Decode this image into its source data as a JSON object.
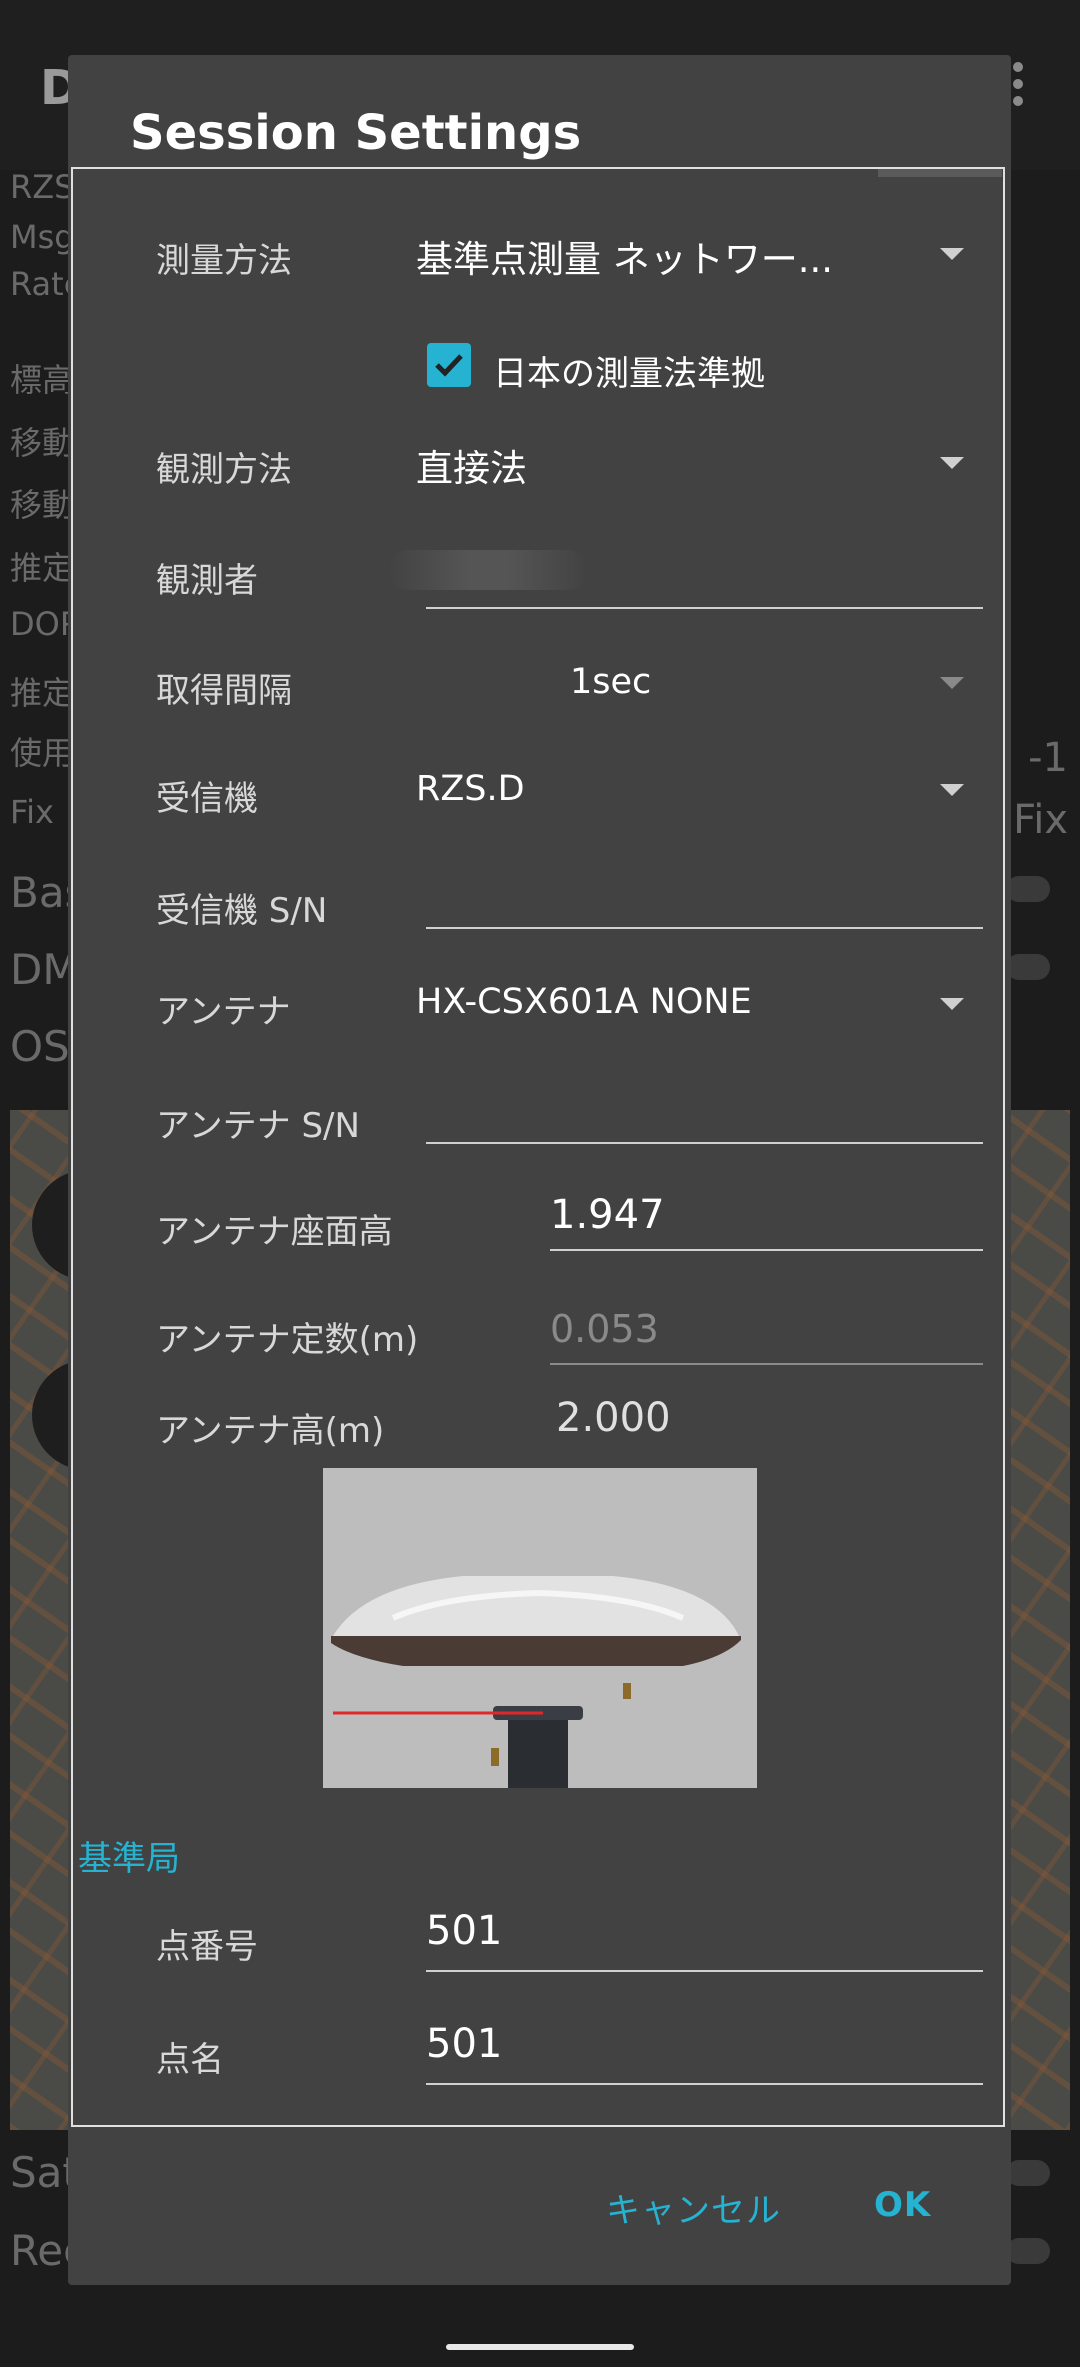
{
  "dialog": {
    "title": "Session Settings",
    "fields": {
      "survey_method_label": "測量方法",
      "survey_method_value": "基準点測量 ネットワー...",
      "japan_law_checkbox_label": "日本の測量法準拠",
      "japan_law_checked": true,
      "observation_method_label": "観測方法",
      "observation_method_value": "直接法",
      "observer_label": "観測者",
      "observer_value": "",
      "interval_label": "取得間隔",
      "interval_value": "1sec",
      "receiver_label": "受信機",
      "receiver_value": "RZS.D",
      "receiver_sn_label": "受信機 S/N",
      "receiver_sn_value": "",
      "antenna_label": "アンテナ",
      "antenna_value": "HX-CSX601A NONE",
      "antenna_sn_label": "アンテナ S/N",
      "antenna_sn_value": "",
      "antenna_mount_height_label": "アンテナ座面高",
      "antenna_mount_height_value": "1.947",
      "antenna_constant_label": "アンテナ定数(m)",
      "antenna_constant_value": "0.053",
      "antenna_height_label": "アンテナ高(m)",
      "antenna_height_value": "2.000"
    },
    "base_station": {
      "section_title": "基準局",
      "point_number_label": "点番号",
      "point_number_value": "501",
      "point_name_label": "点名",
      "point_name_value": "501"
    },
    "buttons": {
      "cancel": "キャンセル",
      "ok": "OK"
    }
  },
  "background": {
    "title_fragment": "D",
    "rows": [
      "RZS",
      "Msg",
      "Rate",
      "標高",
      "移動",
      "移動",
      "推定",
      "DOP",
      "推定",
      "使用",
      "Fix",
      "Bas",
      "DM",
      "OS"
    ],
    "right_values": [
      "-1",
      "Fix"
    ],
    "bottom_rows": [
      "Sat",
      "Rec"
    ]
  },
  "colors": {
    "accent": "#26b3d2",
    "dialog_bg": "#424242"
  }
}
